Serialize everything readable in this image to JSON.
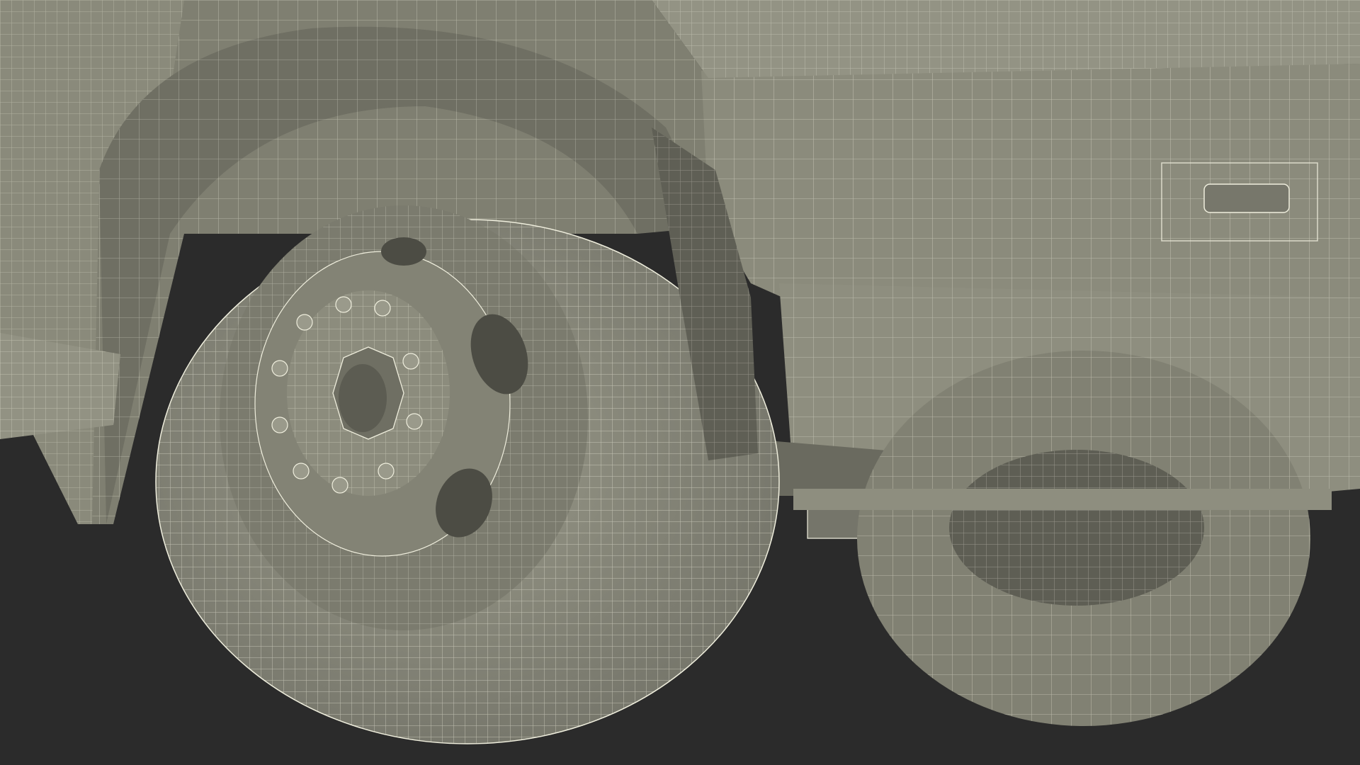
{
  "scene": {
    "subject": "wireframe-render",
    "colors": {
      "background": "#2b2b2b",
      "surface": "#8d8d7d",
      "surface_dark": "#6e6e62",
      "surface_light": "#a3a393",
      "shadow": "#4a4a42",
      "wire": "#efeedd"
    }
  }
}
